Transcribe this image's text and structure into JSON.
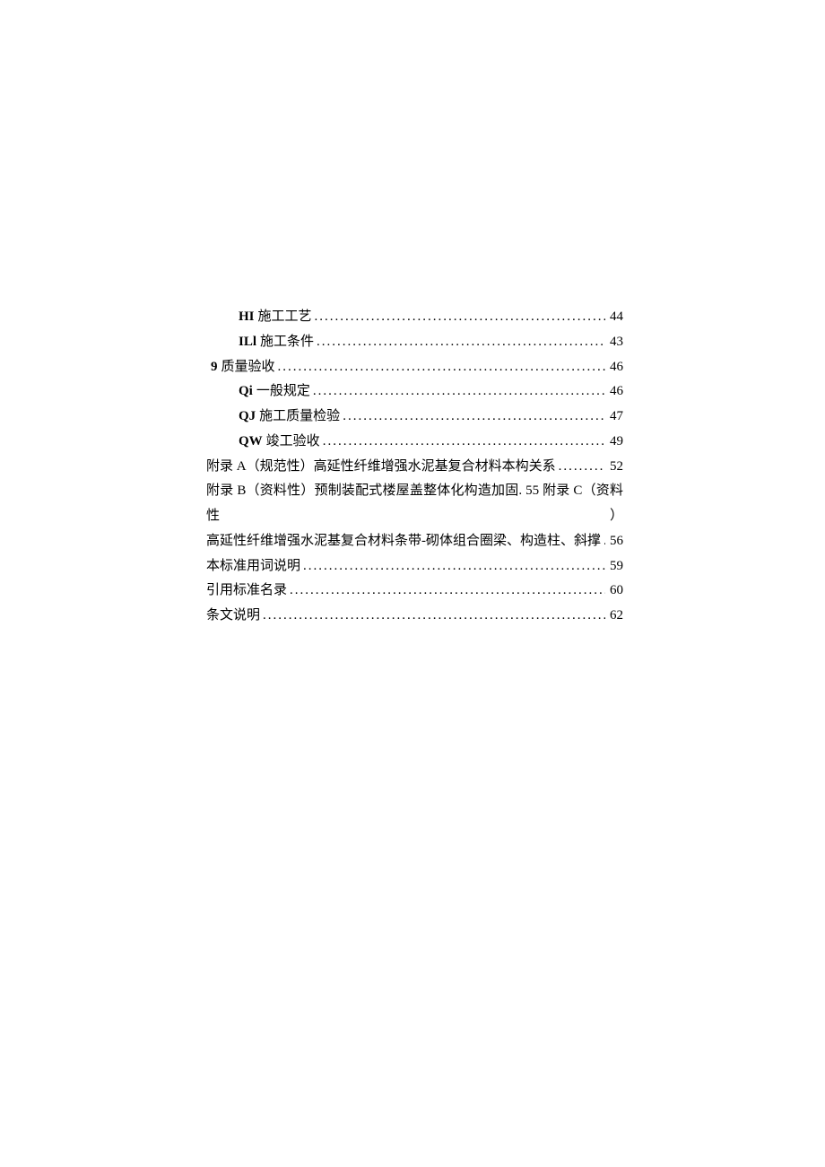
{
  "toc": {
    "rows": [
      {
        "indent": "indent-1",
        "prefix": "HI",
        "prefix_bold": true,
        "title": "施工工艺",
        "page": "44"
      },
      {
        "indent": "indent-1",
        "prefix": "ILl",
        "prefix_bold": true,
        "title": "施工条件",
        "page": "43"
      },
      {
        "indent": "indent-0",
        "prefix": "9",
        "prefix_bold": true,
        "title": "质量验收",
        "page": "46"
      },
      {
        "indent": "indent-1",
        "prefix": "Qi",
        "prefix_bold": true,
        "title": "一般规定",
        "page": "46"
      },
      {
        "indent": "indent-1",
        "prefix": "QJ",
        "prefix_bold": true,
        "title": "施工质量检验",
        "page": "47"
      },
      {
        "indent": "indent-1",
        "prefix": "QW",
        "prefix_bold": true,
        "title": "竣工验收",
        "page": "49"
      }
    ],
    "appendix_a": {
      "title": "附录 A（规范性）高延性纤维增强水泥基复合材料本构关系",
      "page": "52"
    },
    "appendix_b_c_line": "附录 B（资料性）预制装配式楼屋盖整体化构造加固. 55 附录 C（资料性）",
    "appendix_c_cont": {
      "title": "高延性纤维增强水泥基复合材料条带-砌体组合圈梁、构造柱、斜撑",
      "page": "56"
    },
    "tail": [
      {
        "title": "本标准用词说明",
        "page": "59"
      },
      {
        "title": "引用标准名录",
        "page": "60"
      },
      {
        "title": "条文说明",
        "page": "62"
      }
    ]
  }
}
